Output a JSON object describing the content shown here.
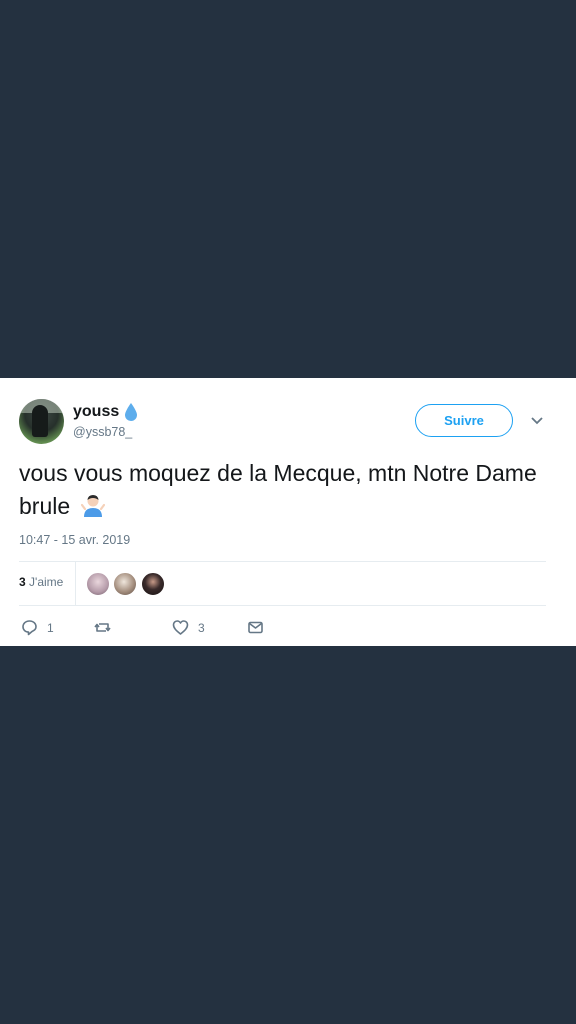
{
  "user": {
    "display_name": "youss",
    "handle": "@yssb78_",
    "name_emoji": "droplet-icon",
    "avatar": "profile-photo"
  },
  "follow_button": {
    "label": "Suivre"
  },
  "menu": {
    "icon": "chevron-down-icon"
  },
  "tweet": {
    "text": "vous vous moquez de la Mecque, mtn Notre Dame brule",
    "emoji": "person-shrugging-icon",
    "timestamp": "10:47 - 15 avr. 2019"
  },
  "likes": {
    "count": "3",
    "label": "J'aime",
    "likers_shown": 3
  },
  "actions": {
    "reply_count": "1",
    "retweet_count": "",
    "like_count": "3",
    "icons": [
      "reply-icon",
      "retweet-icon",
      "like-icon",
      "message-icon"
    ]
  },
  "colors": {
    "background": "#243140",
    "card": "#ffffff",
    "accent": "#1da1f2",
    "text_primary": "#14171a",
    "text_secondary": "#657786"
  }
}
